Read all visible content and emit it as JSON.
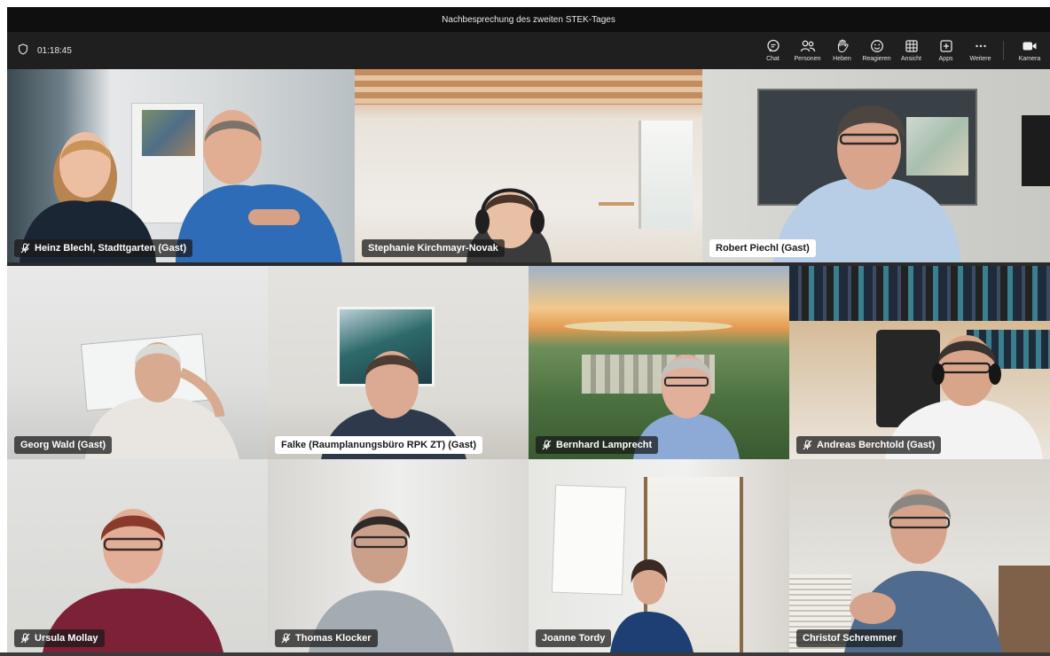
{
  "window": {
    "title": "Nachbesprechung des zweiten STEK-Tages"
  },
  "toolbar": {
    "timer": "01:18:45",
    "buttons": [
      {
        "id": "chat",
        "label": "Chat",
        "icon": "chat-icon"
      },
      {
        "id": "people",
        "label": "Personen",
        "icon": "people-icon"
      },
      {
        "id": "raise",
        "label": "Heben",
        "icon": "raise-hand-icon"
      },
      {
        "id": "react",
        "label": "Reagieren",
        "icon": "smiley-icon"
      },
      {
        "id": "view",
        "label": "Ansicht",
        "icon": "grid-icon"
      },
      {
        "id": "apps",
        "label": "Apps",
        "icon": "plus-square-icon"
      },
      {
        "id": "more",
        "label": "Weitere",
        "icon": "more-icon"
      },
      {
        "id": "camera",
        "label": "Kamera",
        "icon": "camera-icon"
      }
    ]
  },
  "participants": [
    {
      "name": "Heinz Blechl, Stadttgarten (Gast)",
      "muted": true,
      "chip": "dark"
    },
    {
      "name": "Stephanie Kirchmayr-Novak",
      "muted": false,
      "chip": "dark"
    },
    {
      "name": "Robert Piechl (Gast)",
      "muted": false,
      "chip": "light"
    },
    {
      "name": "Georg Wald (Gast)",
      "muted": false,
      "chip": "dark"
    },
    {
      "name": "Falke (Raumplanungsbüro RPK ZT) (Gast)",
      "muted": false,
      "chip": "light"
    },
    {
      "name": "Bernhard Lamprecht",
      "muted": true,
      "chip": "dark"
    },
    {
      "name": "Andreas Berchtold (Gast)",
      "muted": true,
      "chip": "dark"
    },
    {
      "name": "Ursula Mollay",
      "muted": true,
      "chip": "dark"
    },
    {
      "name": "Thomas Klocker",
      "muted": true,
      "chip": "dark"
    },
    {
      "name": "Joanne Tordy",
      "muted": false,
      "chip": "dark"
    },
    {
      "name": "Christof Schremmer",
      "muted": false,
      "chip": "dark"
    }
  ],
  "colors": {
    "titlebar": "#0f0f0f",
    "toolbar": "#1f1f1f",
    "chip_dark": "#1a1a1a",
    "chip_light": "#ffffff"
  }
}
